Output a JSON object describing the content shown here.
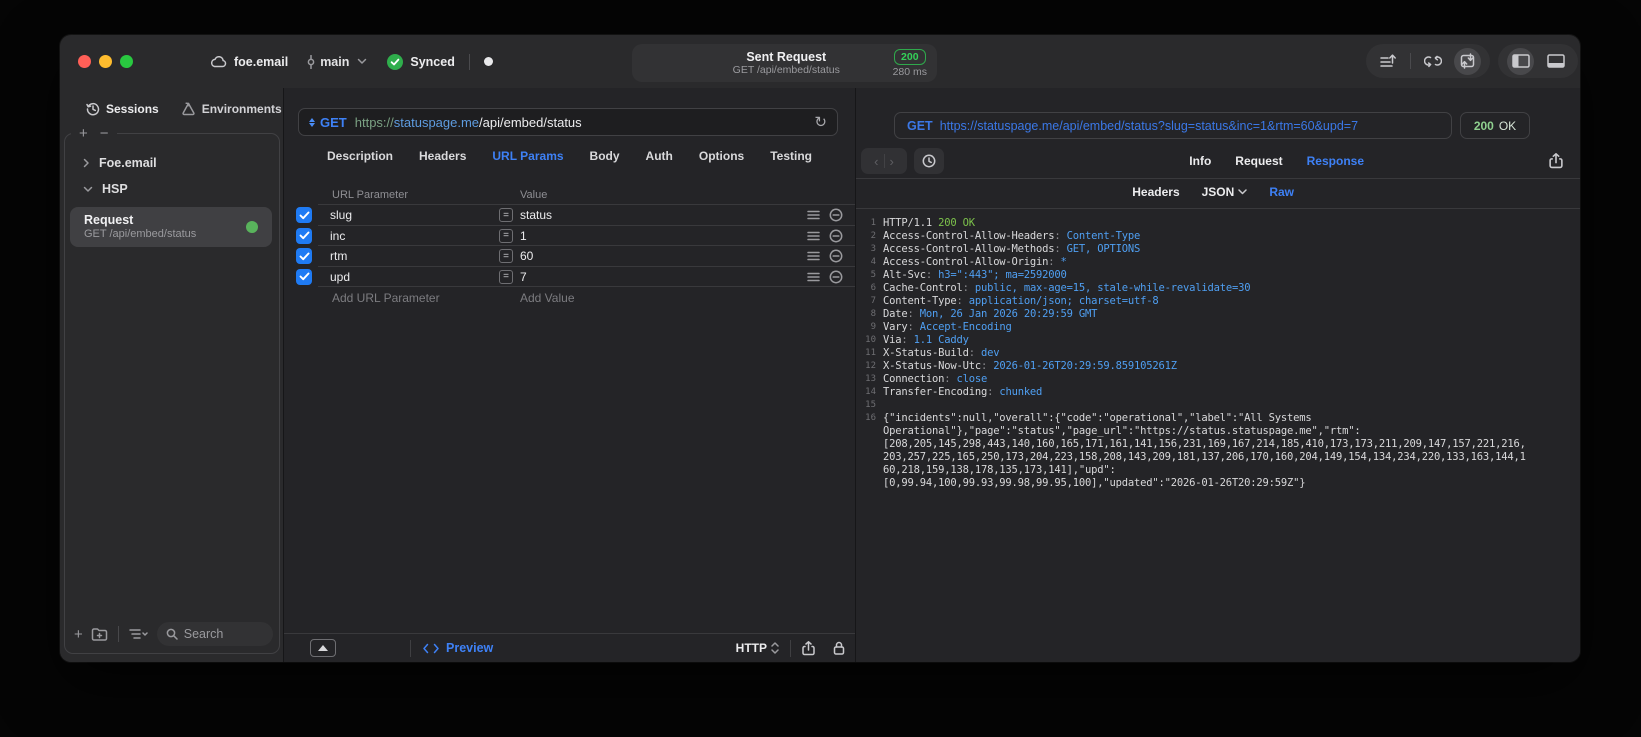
{
  "colors": {
    "accent_blue": "#3e81f6",
    "status_green": "#34d158",
    "method_blue": "#4a8df6",
    "value_blue": "#4f9ff2",
    "ok_green": "#7cc14b",
    "checkbox_blue": "#1f7bf4"
  },
  "icons": [
    "cloud-icon",
    "branch-icon",
    "synced-check-icon",
    "record-dot",
    "sort-lines-icon",
    "sync-loop-icon",
    "import-export-icon",
    "panel-left-icon",
    "panel-bottom-icon",
    "clock-icon",
    "shapes-icon",
    "chevron-right-icon",
    "chevron-down-icon",
    "plus-icon",
    "minus-icon",
    "new-folder-icon",
    "list-order-icon",
    "search-icon",
    "method-updown-icon",
    "reload-icon",
    "equals-icon",
    "row-lines-icon",
    "remove-row-icon",
    "collapse-up-icon",
    "code-icon",
    "updown-chevrons-icon",
    "share-icon",
    "lock-icon",
    "back-icon",
    "forward-icon",
    "history-clock-icon",
    "json-chevron-icon"
  ],
  "titlebar": {
    "project": "foe.email",
    "branch": "main",
    "sync_status": "Synced",
    "title": "Sent Request",
    "subtitle": "GET /api/embed/status",
    "status_code": "200",
    "duration": "280 ms"
  },
  "sidebar": {
    "tabs": [
      {
        "label": "Sessions"
      },
      {
        "label": "Environments"
      }
    ],
    "tree": [
      {
        "label": "Foe.email"
      },
      {
        "label": "HSP"
      }
    ],
    "request_item": {
      "title": "Request",
      "subtitle": "GET /api/embed/status"
    },
    "search_placeholder": "Search"
  },
  "request_panel": {
    "method": "GET",
    "url_scheme": "https://",
    "url_host": "statuspage.me",
    "url_path": "/api/embed/status",
    "tabs": [
      "Description",
      "Headers",
      "URL Params",
      "Body",
      "Auth",
      "Options",
      "Testing"
    ],
    "active_tab": "URL Params",
    "table": {
      "col1": "URL Parameter",
      "col2": "Value",
      "rows": [
        {
          "name": "slug",
          "value": "status",
          "enabled": true
        },
        {
          "name": "inc",
          "value": "1",
          "enabled": true
        },
        {
          "name": "rtm",
          "value": "60",
          "enabled": true
        },
        {
          "name": "upd",
          "value": "7",
          "enabled": true
        }
      ],
      "add_name_placeholder": "Add URL Parameter",
      "add_value_placeholder": "Add Value"
    },
    "footer": {
      "preview_label": "Preview",
      "protocol": "HTTP"
    }
  },
  "response_panel": {
    "method": "GET",
    "url": "https://statuspage.me/api/embed/status?slug=status&inc=1&rtm=60&upd=7",
    "status_code": "200",
    "status_text": "OK",
    "tabs": [
      "Info",
      "Request",
      "Response"
    ],
    "active_tab": "Response",
    "subtabs": [
      "Headers",
      "JSON",
      "Raw"
    ],
    "active_subtab": "Raw",
    "status_line": {
      "version": "HTTP/1.1 ",
      "status": "200 OK"
    },
    "headers": [
      [
        "Access-Control-Allow-Headers",
        "Content-Type"
      ],
      [
        "Access-Control-Allow-Methods",
        "GET, OPTIONS"
      ],
      [
        "Access-Control-Allow-Origin",
        "*"
      ],
      [
        "Alt-Svc",
        "h3=\":443\"; ma=2592000"
      ],
      [
        "Cache-Control",
        "public, max-age=15, stale-while-revalidate=30"
      ],
      [
        "Content-Type",
        "application/json; charset=utf-8"
      ],
      [
        "Date",
        "Mon, 26 Jan 2026 20:29:59 GMT"
      ],
      [
        "Vary",
        "Accept-Encoding"
      ],
      [
        "Via",
        "1.1 Caddy"
      ],
      [
        "X-Status-Build",
        "dev"
      ],
      [
        "X-Status-Now-Utc",
        "2026-01-26T20:29:59.859105261Z"
      ],
      [
        "Connection",
        "close"
      ],
      [
        "Transfer-Encoding",
        "chunked"
      ]
    ],
    "body_lines": [
      "{\"incidents\":null,\"overall\":{\"code\":\"operational\",\"label\":\"All Systems",
      "Operational\"},\"page\":\"status\",\"page_url\":\"https://status.statuspage.me\",\"rtm\":",
      "[208,205,145,298,443,140,160,165,171,161,141,156,231,169,167,214,185,410,173,173,211,209,147,157,221,216,",
      "203,257,225,165,250,173,204,223,158,208,143,209,181,137,206,170,160,204,149,154,134,234,220,133,163,144,1",
      "60,218,159,138,178,135,173,141],\"upd\":",
      "[0,99.94,100,99.93,99.98,99.95,100],\"updated\":\"2026-01-26T20:29:59Z\"}"
    ]
  }
}
